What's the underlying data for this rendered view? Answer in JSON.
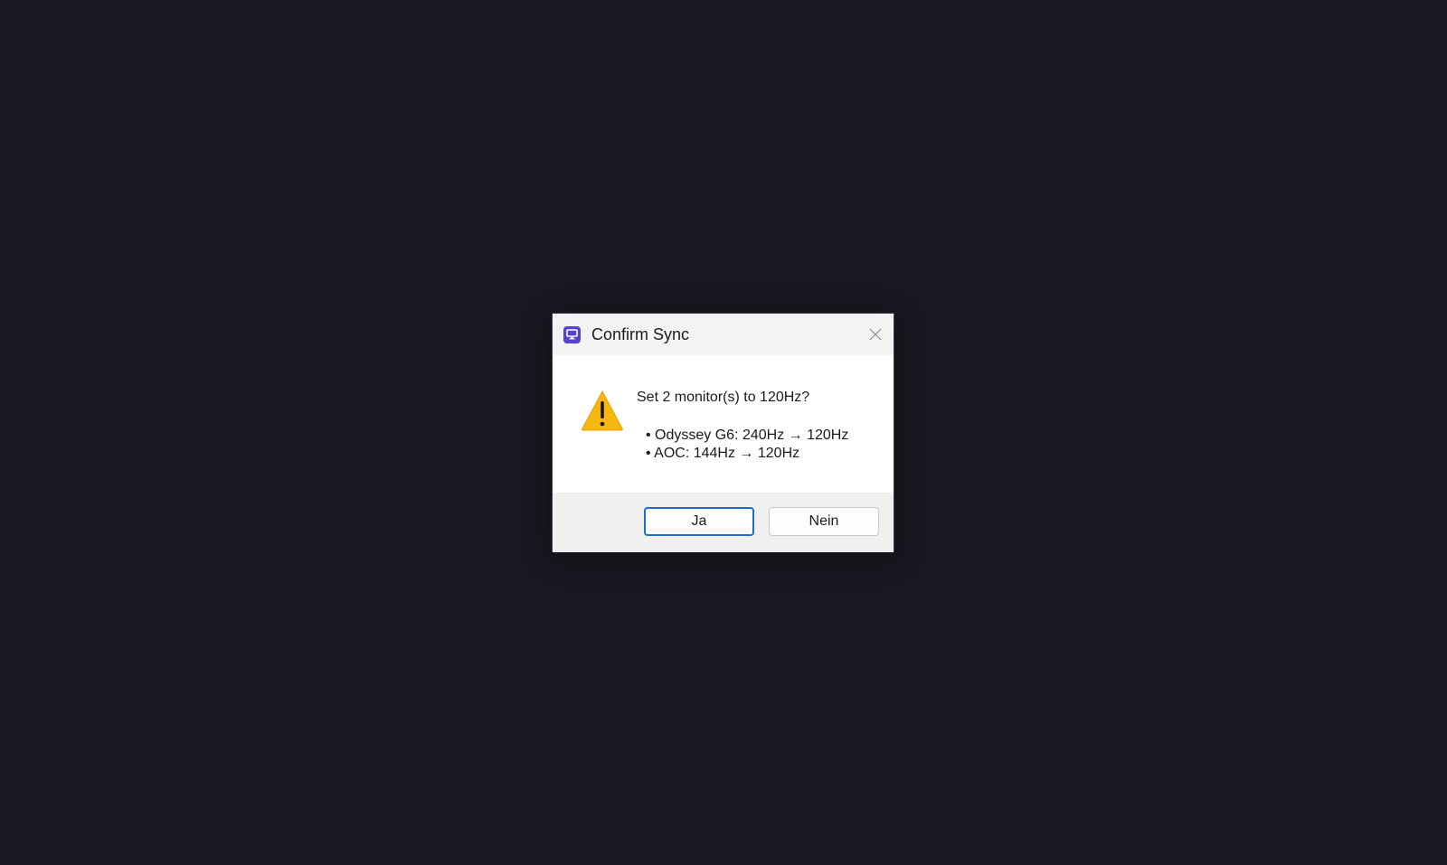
{
  "dialog": {
    "title": "Confirm Sync",
    "app_icon": "monitor-icon",
    "close_icon": "close-icon",
    "warning_icon": "warning-icon",
    "message": "Set 2 monitor(s) to 120Hz?",
    "details": [
      "• Odyssey G6: 240Hz → 120Hz",
      "• AOC: 144Hz → 120Hz"
    ],
    "buttons": {
      "yes_label": "Ja",
      "no_label": "Nein"
    }
  },
  "colors": {
    "background": "#181920",
    "app_icon": "#5b3fd1",
    "warning": "#f6b80f",
    "focus_border": "#1b6fd1"
  }
}
